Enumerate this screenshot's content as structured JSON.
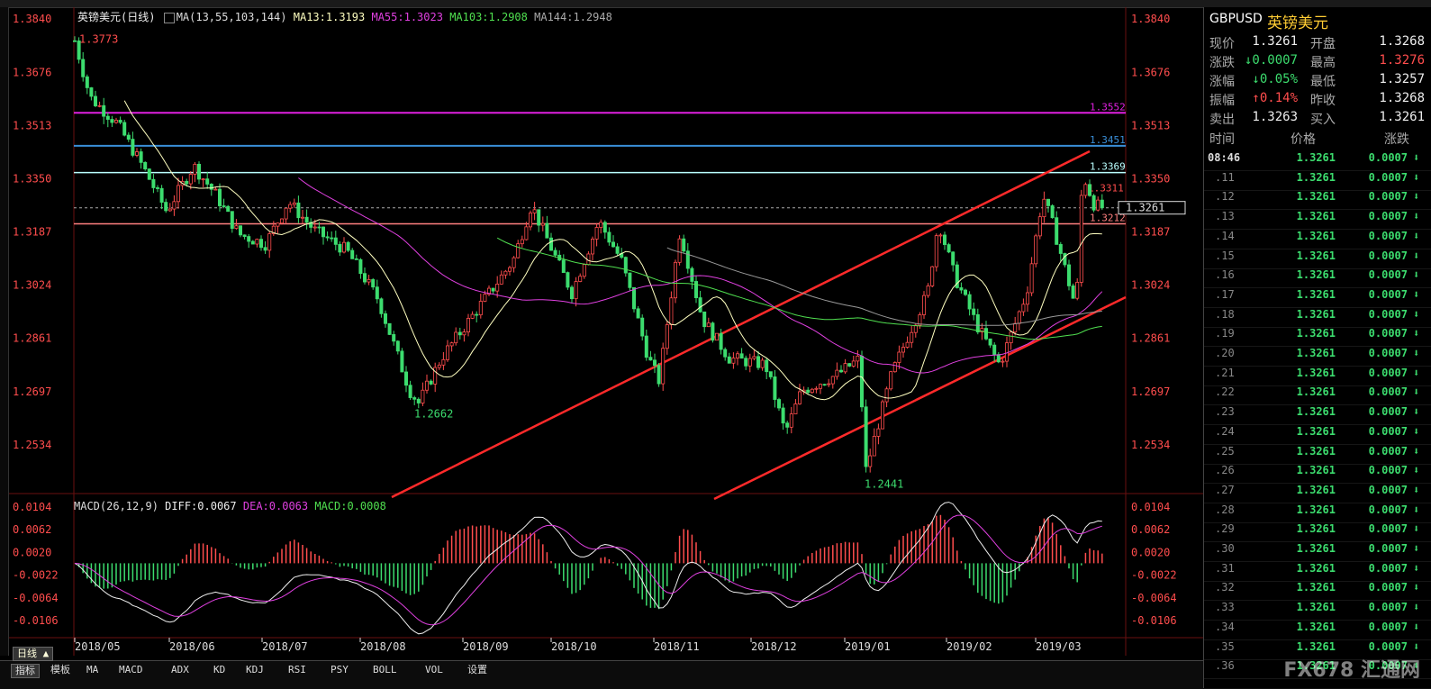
{
  "header": {
    "title": "英镑美元(日线)",
    "ma_label": "MA(13,55,103,144)",
    "ma13": "MA13:1.3193",
    "ma55": "MA55:1.3023",
    "ma103": "MA103:1.2908",
    "ma144": "MA144:1.2948"
  },
  "price_axis": [
    "1.3840",
    "1.3676",
    "1.3513",
    "1.3350",
    "1.3187",
    "1.3024",
    "1.2861",
    "1.2697",
    "1.2534"
  ],
  "macd_axis": [
    "0.0104",
    "0.0062",
    "0.0020",
    "-0.0022",
    "-0.0064",
    "-0.0106"
  ],
  "macd_header": {
    "label": "MACD(26,12,9)",
    "diff": "DIFF:0.0067",
    "dea": "DEA:0.0063",
    "macd": "MACD:0.0008"
  },
  "annotations": {
    "high": "1.3773",
    "low1": "1.2662",
    "low2": "1.2441",
    "level1": "1.3552",
    "level2": "1.3451",
    "level3": "1.3369",
    "level4": "1.3212",
    "current": "1.3261",
    "hidden": "1.3311"
  },
  "date_axis": [
    "2018/05",
    "2018/06",
    "2018/07",
    "2018/08",
    "2018/09",
    "2018/10",
    "2018/11",
    "2018/12",
    "2019/01",
    "2019/02",
    "2019/03"
  ],
  "bottom_tabs": {
    "period": "日线 ▲",
    "tabs": [
      "指标",
      "模板",
      "MA",
      "MACD",
      "ADX",
      "KD",
      "KDJ",
      "RSI",
      "PSY",
      "BOLL",
      "VOL",
      "设置"
    ]
  },
  "quote": {
    "symbol": "GBPUSD",
    "name": "英镑美元",
    "rows": [
      {
        "l1": "现价",
        "v1": "1.3261",
        "l2": "开盘",
        "v2": "1.3268"
      },
      {
        "l1": "涨跌",
        "v1": "↓0.0007",
        "l2": "最高",
        "v2": "1.3276"
      },
      {
        "l1": "涨幅",
        "v1": "↓0.05%",
        "l2": "最低",
        "v2": "1.3257"
      },
      {
        "l1": "振幅",
        "v1": "↑0.14%",
        "l2": "昨收",
        "v2": "1.3268"
      },
      {
        "l1": "卖出",
        "v1": "1.3263",
        "l2": "买入",
        "v2": "1.3261"
      }
    ],
    "tick_headers": [
      "时间",
      "价格",
      "涨跌"
    ],
    "ticks": [
      {
        "t": "08:46",
        "p": "1.3261",
        "c": "0.0007"
      },
      {
        "t": ".11",
        "p": "1.3261",
        "c": "0.0007"
      },
      {
        "t": ".12",
        "p": "1.3261",
        "c": "0.0007"
      },
      {
        "t": ".13",
        "p": "1.3261",
        "c": "0.0007"
      },
      {
        "t": ".14",
        "p": "1.3261",
        "c": "0.0007"
      },
      {
        "t": ".15",
        "p": "1.3261",
        "c": "0.0007"
      },
      {
        "t": ".16",
        "p": "1.3261",
        "c": "0.0007"
      },
      {
        "t": ".17",
        "p": "1.3261",
        "c": "0.0007"
      },
      {
        "t": ".18",
        "p": "1.3261",
        "c": "0.0007"
      },
      {
        "t": ".19",
        "p": "1.3261",
        "c": "0.0007"
      },
      {
        "t": ".20",
        "p": "1.3261",
        "c": "0.0007"
      },
      {
        "t": ".21",
        "p": "1.3261",
        "c": "0.0007"
      },
      {
        "t": ".22",
        "p": "1.3261",
        "c": "0.0007"
      },
      {
        "t": ".23",
        "p": "1.3261",
        "c": "0.0007"
      },
      {
        "t": ".24",
        "p": "1.3261",
        "c": "0.0007"
      },
      {
        "t": ".25",
        "p": "1.3261",
        "c": "0.0007"
      },
      {
        "t": ".26",
        "p": "1.3261",
        "c": "0.0007"
      },
      {
        "t": ".27",
        "p": "1.3261",
        "c": "0.0007"
      },
      {
        "t": ".28",
        "p": "1.3261",
        "c": "0.0007"
      },
      {
        "t": ".29",
        "p": "1.3261",
        "c": "0.0007"
      },
      {
        "t": ".30",
        "p": "1.3261",
        "c": "0.0007"
      },
      {
        "t": ".31",
        "p": "1.3261",
        "c": "0.0007"
      },
      {
        "t": ".32",
        "p": "1.3261",
        "c": "0.0007"
      },
      {
        "t": ".33",
        "p": "1.3261",
        "c": "0.0007"
      },
      {
        "t": ".34",
        "p": "1.3261",
        "c": "0.0007"
      },
      {
        "t": ".35",
        "p": "1.3261",
        "c": "0.0007"
      },
      {
        "t": ".36",
        "p": "1.3261",
        "c": "0.0007"
      }
    ]
  },
  "watermark": "FX678 汇通网",
  "colors": {
    "up": "#ff4d4d",
    "down": "#3cdc6e",
    "magenta": "#e020e0",
    "blue": "#3a8fd8",
    "cyan": "#bff",
    "red": "#ff2a2a"
  }
}
